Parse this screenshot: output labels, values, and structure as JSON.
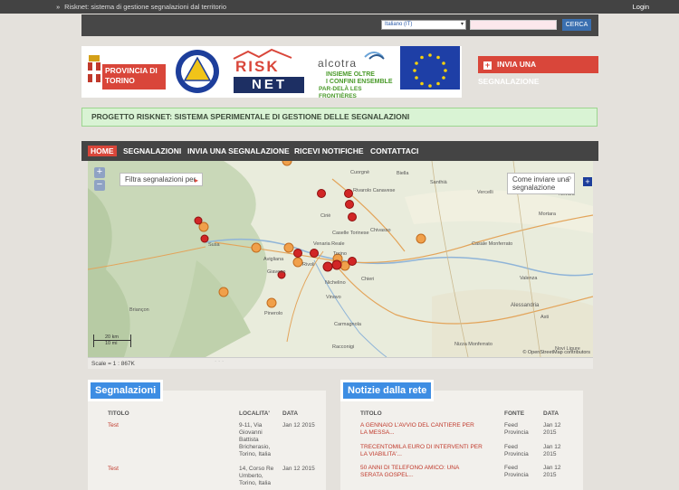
{
  "topbar": {
    "breadcrumb": "Risknet: sistema di gestione segnalazioni dal territorio",
    "login": "Login"
  },
  "search": {
    "language": "Italiano (IT)",
    "button": "CERCA"
  },
  "logos": {
    "provincia": "PROVINCIA DI TORINO",
    "risknet_top": "RISK",
    "risknet_bottom": "NET",
    "alcotra": "alcotra",
    "alcotra_line1": "INSIEME OLTRE",
    "alcotra_line2": "I CONFINI ENSEMBLE",
    "alcotra_line3": "PAR-DELÀ LES FRONTIÈRES"
  },
  "send_button": "INVIA UNA SEGNALAZIONE",
  "project_banner": "PROGETTO RISKNET: SISTEMA SPERIMENTALE DI GESTIONE DELLE SEGNALAZIONI",
  "nav": [
    "HOME",
    "SEGNALAZIONI",
    "INVIA UNA SEGNALAZIONE",
    "RICEVI NOTIFICHE",
    "CONTATTACI"
  ],
  "map": {
    "filter_label": "Filtra segnalazioni per",
    "howto_label": "Come inviare una segnalazione",
    "scale_km": "20 km",
    "scale_mi": "10 mi",
    "attribution": "© OpenStreetMap contributors",
    "towns": [
      "Cuorgnè",
      "Rivarolo Canavese",
      "Ciriè",
      "Caselle Torinese",
      "Chivasso",
      "Venaria Reale",
      "Rivoli",
      "Torino",
      "Avigliana",
      "Giaveno",
      "Pinerolo",
      "Nichelino",
      "Chieri",
      "Vinovo",
      "Carmagnola",
      "Asti",
      "Alessandria",
      "Casale Monferrato",
      "Valenza",
      "Susa",
      "Biella",
      "Vercelli",
      "Novara",
      "Santhià",
      "Mortara",
      "Racconigi",
      "Nizza Monferrato",
      "Novi Ligure",
      "Briançon"
    ]
  },
  "scale_text": "Scale = 1 : 867K",
  "segnalazioni": {
    "title": "Segnalazioni",
    "headers": [
      "TITOLO",
      "LOCALITA'",
      "DATA"
    ],
    "rows": [
      {
        "title": "Test",
        "place": "9-11, Via Giovanni Battista Bricherasio, Torino, Italia",
        "date": "Jan 12 2015"
      },
      {
        "title": "Test",
        "place": "14, Corso Re Umberto, Torino, Italia",
        "date": "Jan 12 2015"
      }
    ]
  },
  "notizie": {
    "title": "Notizie dalla rete",
    "headers": [
      "TITOLO",
      "FONTE",
      "DATA"
    ],
    "rows": [
      {
        "title": "A GENNAIO L'AVVIO DEL CANTIERE PER LA MESSA...",
        "source": "Feed Provincia",
        "date": "Jan 12 2015"
      },
      {
        "title": "TRECENTOMILA EURO DI INTERVENTI PER LA VIABILITA'...",
        "source": "Feed Provincia",
        "date": "Jan 12 2015"
      },
      {
        "title": "50 ANNI DI TELEFONO AMICO: UNA SERATA GOSPEL...",
        "source": "Feed Provincia",
        "date": "Jan 12 2015"
      }
    ]
  }
}
